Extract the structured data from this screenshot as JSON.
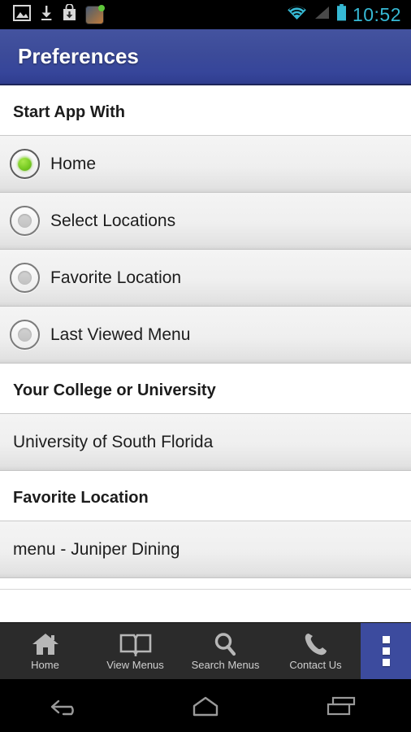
{
  "statusbar": {
    "time": "10:52",
    "icons": [
      "gallery-image-icon",
      "download-icon",
      "app-install-icon",
      "app-badge-icon"
    ],
    "right_icons": [
      "wifi-icon",
      "cellular-signal-icon",
      "battery-icon"
    ],
    "accent_color": "#36b9d4"
  },
  "actionbar": {
    "title": "Preferences",
    "color": "#3c4b99"
  },
  "sections": [
    {
      "header": "Start App With",
      "type": "radio",
      "options": [
        {
          "label": "Home",
          "selected": true
        },
        {
          "label": "Select Locations",
          "selected": false
        },
        {
          "label": "Favorite Location",
          "selected": false
        },
        {
          "label": "Last Viewed Menu",
          "selected": false
        }
      ]
    },
    {
      "header": "Your College or University",
      "type": "value",
      "value": "University of South Florida"
    },
    {
      "header": "Favorite Location",
      "type": "value",
      "value": "menu - Juniper Dining"
    }
  ],
  "tabbar": {
    "tabs": [
      {
        "label": "Home",
        "icon": "home-icon"
      },
      {
        "label": "View Menus",
        "icon": "book-icon"
      },
      {
        "label": "Search Menus",
        "icon": "search-icon"
      },
      {
        "label": "Contact Us",
        "icon": "phone-icon"
      }
    ],
    "overflow_icon": "overflow-menu-icon",
    "overflow_color": "#3c4b9e"
  },
  "navbar": {
    "buttons": [
      "back-button",
      "home-button",
      "recents-button"
    ]
  }
}
